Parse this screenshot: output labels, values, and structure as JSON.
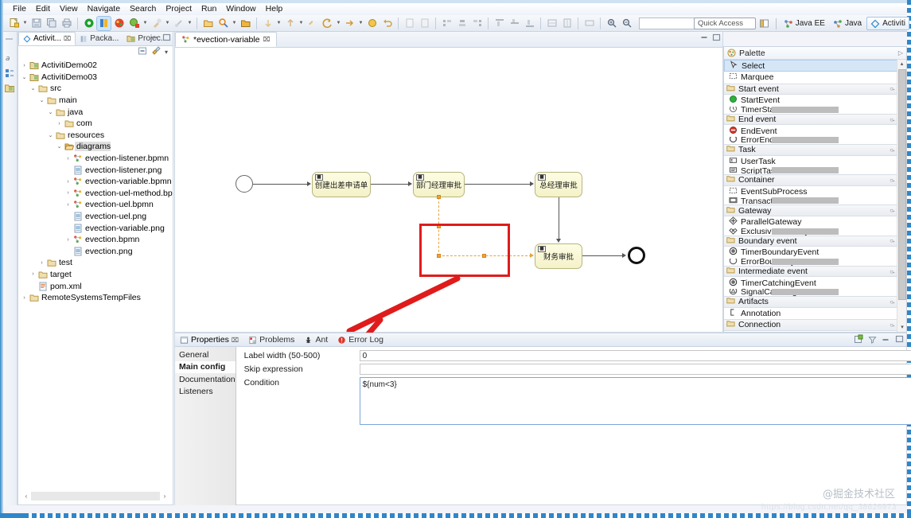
{
  "menu": {
    "items": [
      "File",
      "Edit",
      "View",
      "Navigate",
      "Search",
      "Project",
      "Run",
      "Window",
      "Help"
    ]
  },
  "toolbar": {
    "combo_value": ""
  },
  "quick_access": {
    "placeholder": "Quick Access",
    "value": "Quick Access"
  },
  "perspectives": {
    "open_icon": "open-perspective-icon",
    "items": [
      {
        "label": "Java EE",
        "icon": "java-ee-icon",
        "active": false
      },
      {
        "label": "Java",
        "icon": "java-icon",
        "active": false
      },
      {
        "label": "Activiti",
        "icon": "activiti-icon",
        "active": true
      }
    ]
  },
  "explorer": {
    "tabs": [
      {
        "label": "Activit...",
        "icon": "activiti-icon",
        "active": true,
        "close": "⌧"
      },
      {
        "label": "Packa...",
        "icon": "package-explorer-icon",
        "active": false
      },
      {
        "label": "Projec...",
        "icon": "project-explorer-icon",
        "active": false
      }
    ],
    "view_minimize": "minimize-icon",
    "view_maximize": "maximize-icon",
    "toolbar_icons": [
      "collapse-all-icon",
      "link-with-editor-icon",
      "view-menu-icon"
    ],
    "tree": [
      {
        "depth": 0,
        "twisty": "›",
        "icon": "project-icon",
        "label": "ActivitiDemo02",
        "selected": false
      },
      {
        "depth": 0,
        "twisty": "⌄",
        "icon": "project-icon",
        "label": "ActivitiDemo03",
        "selected": false
      },
      {
        "depth": 1,
        "twisty": "⌄",
        "icon": "folder-icon",
        "label": "src",
        "selected": false
      },
      {
        "depth": 2,
        "twisty": "⌄",
        "icon": "folder-icon",
        "label": "main",
        "selected": false
      },
      {
        "depth": 3,
        "twisty": "⌄",
        "icon": "folder-icon",
        "label": "java",
        "selected": false
      },
      {
        "depth": 4,
        "twisty": "›",
        "icon": "folder-icon",
        "label": "com",
        "selected": false
      },
      {
        "depth": 3,
        "twisty": "⌄",
        "icon": "folder-icon",
        "label": "resources",
        "selected": false
      },
      {
        "depth": 4,
        "twisty": "⌄",
        "icon": "folder-open-icon",
        "label": "diagrams",
        "selected": true
      },
      {
        "depth": 5,
        "twisty": "›",
        "icon": "bpmn-file-icon",
        "label": "evection-listener.bpmn",
        "selected": false
      },
      {
        "depth": 5,
        "twisty": "",
        "icon": "image-file-icon",
        "label": "evection-listener.png",
        "selected": false
      },
      {
        "depth": 5,
        "twisty": "›",
        "icon": "bpmn-file-icon",
        "label": "evection-variable.bpmn",
        "selected": false
      },
      {
        "depth": 5,
        "twisty": "›",
        "icon": "bpmn-file-icon",
        "label": "evection-uel-method.bpmn",
        "selected": false
      },
      {
        "depth": 5,
        "twisty": "›",
        "icon": "bpmn-file-icon",
        "label": "evection-uel.bpmn",
        "selected": false
      },
      {
        "depth": 5,
        "twisty": "",
        "icon": "image-file-icon",
        "label": "evection-uel.png",
        "selected": false
      },
      {
        "depth": 5,
        "twisty": "",
        "icon": "image-file-icon",
        "label": "evection-variable.png",
        "selected": false
      },
      {
        "depth": 5,
        "twisty": "›",
        "icon": "bpmn-file-icon",
        "label": "evection.bpmn",
        "selected": false
      },
      {
        "depth": 5,
        "twisty": "",
        "icon": "image-file-icon",
        "label": "evection.png",
        "selected": false
      },
      {
        "depth": 2,
        "twisty": "›",
        "icon": "folder-icon",
        "label": "test",
        "selected": false
      },
      {
        "depth": 1,
        "twisty": "›",
        "icon": "folder-icon",
        "label": "target",
        "selected": false
      },
      {
        "depth": 1,
        "twisty": "",
        "icon": "pom-file-icon",
        "label": "pom.xml",
        "selected": false
      },
      {
        "depth": 0,
        "twisty": "›",
        "icon": "folder-icon",
        "label": "RemoteSystemsTempFiles",
        "selected": false
      }
    ]
  },
  "editor": {
    "tab": {
      "label": "*evection-variable",
      "icon": "bpmn-file-icon",
      "close": "⌧",
      "dirty": true
    },
    "minimize": "minimize-icon",
    "maximize": "maximize-icon"
  },
  "diagram": {
    "start_event": {
      "name": "start-event"
    },
    "end_event": {
      "name": "end-event"
    },
    "tasks": [
      {
        "label": "创建出差申请单",
        "name": "task-create-evection-request"
      },
      {
        "label": "部门经理审批",
        "name": "task-department-manager-approval"
      },
      {
        "label": "总经理审批",
        "name": "task-general-manager-approval"
      },
      {
        "label": "财务审批",
        "name": "task-finance-approval"
      }
    ],
    "selected_flow": "conditional-sequence-flow",
    "annotation": {
      "box": "red-highlight-box",
      "arrow": "red-pointer-arrow"
    }
  },
  "palette": {
    "title": "Palette",
    "collapse_icon": "palette-collapse-icon",
    "tools": [
      {
        "label": "Select",
        "icon": "select-cursor-icon",
        "selected": true
      },
      {
        "label": "Marquee",
        "icon": "marquee-icon",
        "selected": false
      }
    ],
    "groups": [
      {
        "label": "Start event",
        "items": [
          {
            "label": "StartEvent",
            "icon": "start-event-icon"
          },
          {
            "label": "TimerStartEvent",
            "icon": "timer-start-event-icon",
            "partial": true
          }
        ]
      },
      {
        "label": "End event",
        "items": [
          {
            "label": "EndEvent",
            "icon": "end-event-icon"
          },
          {
            "label": "ErrorEndEvent",
            "icon": "error-end-event-icon",
            "partial": true
          }
        ]
      },
      {
        "label": "Task",
        "items": [
          {
            "label": "UserTask",
            "icon": "user-task-icon"
          },
          {
            "label": "ScriptTask",
            "icon": "script-task-icon",
            "partial": true
          }
        ]
      },
      {
        "label": "Container",
        "items": [
          {
            "label": "EventSubProcess",
            "icon": "event-subprocess-icon"
          },
          {
            "label": "Transaction",
            "icon": "transaction-icon",
            "partial": true
          }
        ]
      },
      {
        "label": "Gateway",
        "items": [
          {
            "label": "ParallelGateway",
            "icon": "parallel-gateway-icon"
          },
          {
            "label": "ExclusiveGateway",
            "icon": "exclusive-gateway-icon",
            "partial": true
          }
        ]
      },
      {
        "label": "Boundary event",
        "items": [
          {
            "label": "TimerBoundaryEvent",
            "icon": "timer-boundary-event-icon"
          },
          {
            "label": "ErrorBoundaryEvent",
            "icon": "error-boundary-event-icon",
            "partial": true
          }
        ]
      },
      {
        "label": "Intermediate event",
        "items": [
          {
            "label": "TimerCatchingEvent",
            "icon": "timer-catching-event-icon"
          },
          {
            "label": "SignalCatchingEvent",
            "icon": "signal-catching-event-icon",
            "partial": true
          }
        ]
      },
      {
        "label": "Artifacts",
        "items": [
          {
            "label": "Annotation",
            "icon": "annotation-icon"
          }
        ]
      },
      {
        "label": "Connection",
        "items": []
      }
    ]
  },
  "properties": {
    "tabs": [
      {
        "label": "Properties",
        "icon": "properties-icon",
        "active": true,
        "close": "⌧"
      },
      {
        "label": "Problems",
        "icon": "problems-icon",
        "active": false
      },
      {
        "label": "Ant",
        "icon": "ant-icon",
        "active": false
      },
      {
        "label": "Error Log",
        "icon": "error-log-icon",
        "active": false
      }
    ],
    "toolbar_icons": [
      "new-properties-view-icon",
      "filter-icon",
      "minimize-icon",
      "maximize-icon"
    ],
    "nav": [
      {
        "label": "General",
        "active": false
      },
      {
        "label": "Main config",
        "active": true
      },
      {
        "label": "Documentation",
        "active": false
      },
      {
        "label": "Listeners",
        "active": false
      }
    ],
    "fields": [
      {
        "label": "Label width (50-500)",
        "value": "0",
        "type": "text",
        "name": "label-width-field"
      },
      {
        "label": "Skip expression",
        "value": "",
        "type": "text",
        "name": "skip-expression-field"
      },
      {
        "label": "Condition",
        "value": "${num<3}",
        "type": "textarea",
        "name": "condition-field"
      }
    ]
  },
  "watermark": {
    "text": "@掘金技术社区",
    "sub": "https://blog.csdn.net/qq_38626973"
  },
  "colors": {
    "accent": "#2f86c9",
    "annotation_red": "#e01b1b",
    "selection_orange": "#f0a430",
    "task_fill": "#f4f2c8"
  }
}
